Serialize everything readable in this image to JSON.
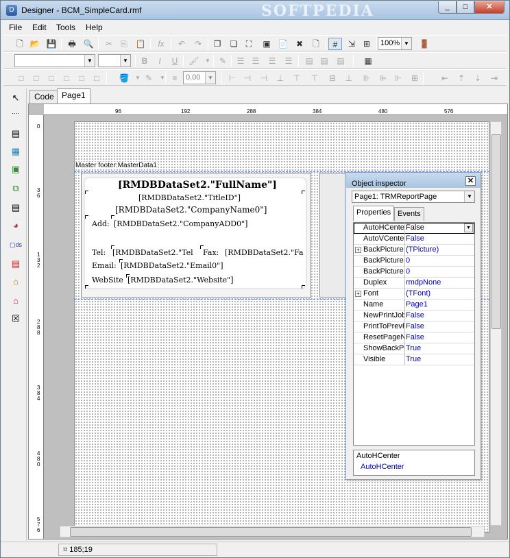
{
  "window": {
    "title": "Designer - BCM_SimpleCard.rmf",
    "watermark": "SOFTPEDIA",
    "min": "_",
    "max": "□",
    "close": "✕"
  },
  "menu": [
    "File",
    "Edit",
    "Tools",
    "Help"
  ],
  "toolbar": {
    "zoom": "100%",
    "font_size_value": "0.00"
  },
  "tabs": [
    "Code",
    "Page1"
  ],
  "ruler": {
    "h": [
      "96",
      "192",
      "288",
      "384",
      "480",
      "576"
    ],
    "v": [
      "0",
      "3\n6",
      "1\n3\n2",
      "2\n8\n8",
      "3\n8\n4",
      "4\n8\n0",
      "5\n7\n6"
    ]
  },
  "band": {
    "label": "Master footer:MasterData1"
  },
  "card": {
    "fullname": "[RMDBDataSet2.\"FullName\"]",
    "title": "[RMDBDataSet2.\"TitleID\"]",
    "company": "[RMDBDataSet2.\"CompanyName0\"]",
    "add_label": "Add:",
    "add_value": "[RMDBDataSet2.\"CompanyADD0\"]",
    "tel_label": "Tel:",
    "tel_value": "[RMDBDataSet2.\"Tel",
    "fax_label": "Fax:",
    "fax_value": "[RMDBDataSet2.\"Fa",
    "email_label": "Email:",
    "email_value": "[RMDBDataSet2.\"Email0\"]",
    "web_label": "WebSite",
    "web_value": "[RMDBDataSet2.\"Website\"]"
  },
  "inspector": {
    "title": "Object inspector",
    "close": "✕",
    "object": "Page1: TRMReportPage",
    "tab_properties": "Properties",
    "tab_events": "Events",
    "properties": [
      {
        "name": "AutoHCenter",
        "value": "False",
        "expand": false,
        "selected": true
      },
      {
        "name": "AutoVCenter",
        "value": "False",
        "expand": false
      },
      {
        "name": "BackPicture",
        "value": "(TPicture)",
        "expand": true
      },
      {
        "name": "BackPicture",
        "value": "0",
        "expand": false
      },
      {
        "name": "BackPicture",
        "value": "0",
        "expand": false
      },
      {
        "name": "Duplex",
        "value": "rmdpNone",
        "expand": false
      },
      {
        "name": "Font",
        "value": "(TFont)",
        "expand": true
      },
      {
        "name": "Name",
        "value": "Page1",
        "expand": false
      },
      {
        "name": "NewPrintJob",
        "value": "False",
        "expand": false
      },
      {
        "name": "PrintToPrevP",
        "value": "False",
        "expand": false
      },
      {
        "name": "ResetPageN",
        "value": "False",
        "expand": false
      },
      {
        "name": "ShowBackP",
        "value": "True",
        "expand": false
      },
      {
        "name": "Visible",
        "value": "True",
        "expand": false
      }
    ],
    "help_title": "AutoHCenter",
    "help_value": "AutoHCenter"
  },
  "status": {
    "coords": "185;19"
  }
}
